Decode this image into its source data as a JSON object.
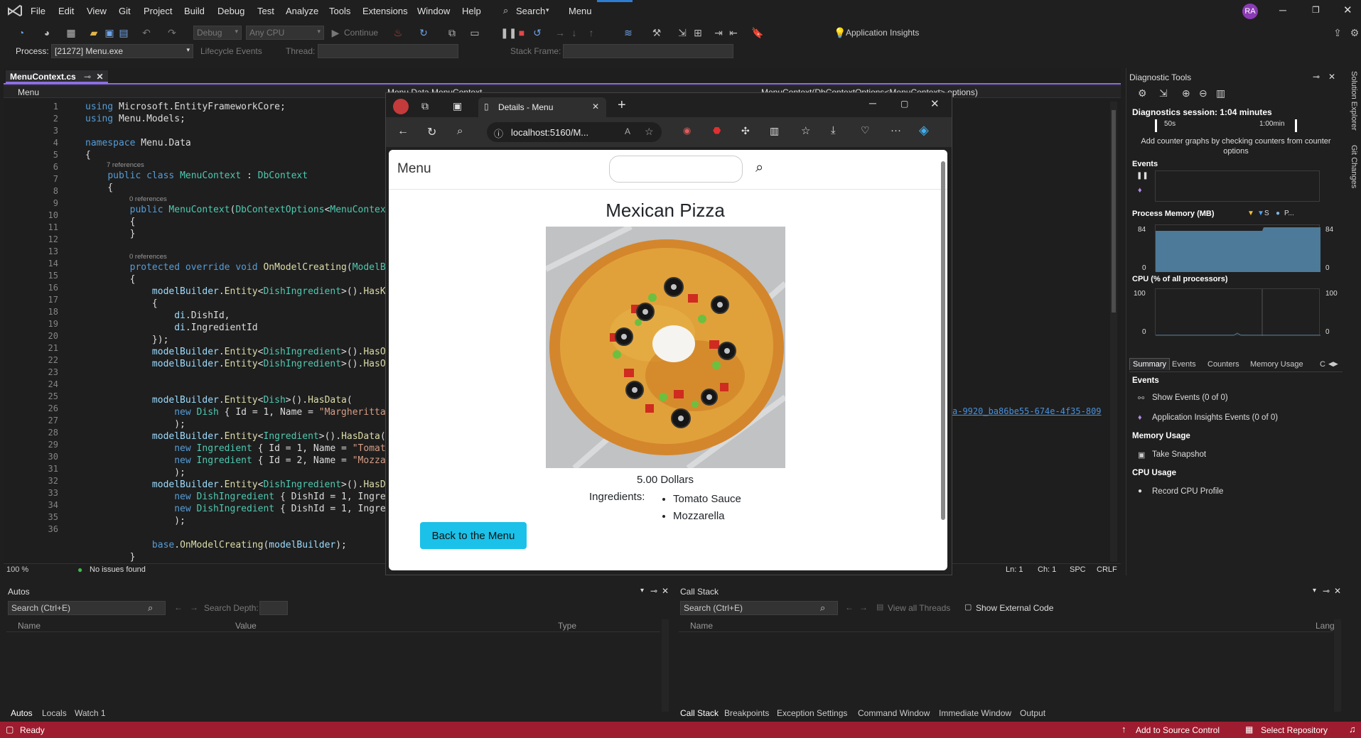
{
  "menubar": {
    "items": [
      "File",
      "Edit",
      "View",
      "Git",
      "Project",
      "Build",
      "Debug",
      "Test",
      "Analyze",
      "Tools",
      "Extensions",
      "Window",
      "Help"
    ],
    "search": "Search",
    "title": "Menu",
    "avatar": "RA"
  },
  "toolbar": {
    "config": "Debug",
    "platform": "Any CPU",
    "continue": "Continue",
    "insights": "Application Insights"
  },
  "toolbar2": {
    "process_label": "Process:",
    "process_value": "[21272] Menu.exe",
    "lifecycle": "Lifecycle Events",
    "thread": "Thread:",
    "stackframe": "Stack Frame:"
  },
  "editor": {
    "tab": "MenuContext.cs",
    "nav_left": "Menu",
    "nav_mid": "Menu.Data.MenuContext",
    "nav_right": "MenuContext(DbContextOptions<MenuContext> options)",
    "zoom": "100 %",
    "issues": "No issues found",
    "ln": "Ln: 1",
    "ch": "Ch: 1",
    "spc": "SPC",
    "crlf": "CRLF",
    "guid": "a-9920_ba86be55-674e-4f35-809",
    "refs": {
      "r7": "7 references",
      "r0a": "0 references",
      "r0b": "0 references"
    },
    "lines": [
      "1",
      "2",
      "3",
      "4",
      "5",
      "6",
      "7",
      "8",
      "9",
      "10",
      "11",
      "12",
      "13",
      "14",
      "15",
      "16",
      "17",
      "18",
      "19",
      "20",
      "21",
      "22",
      "23",
      "24",
      "25",
      "26",
      "27",
      "28",
      "29",
      "30",
      "31",
      "32",
      "33",
      "34",
      "35",
      "36"
    ]
  },
  "browser": {
    "tab_title": "Details - Menu",
    "url": "localhost:5160/M..."
  },
  "page": {
    "brand": "Menu",
    "search_placeholder": "",
    "title": "Mexican Pizza",
    "price": "5.00 Dollars",
    "ingredients_label": "Ingredients:",
    "ingredients": [
      "Tomato Sauce",
      "Mozzarella"
    ],
    "back_button": "Back to the Menu"
  },
  "diagnostics": {
    "title": "Diagnostic Tools",
    "session": "Diagnostics session: 1:04 minutes",
    "t1": "50s",
    "t2": "1:00min",
    "hint": "Add counter graphs by checking counters from counter options",
    "events": "Events",
    "memory": "Process Memory (MB)",
    "mem_legend_s": "S",
    "mem_legend_p": "P...",
    "mem_max": "84",
    "mem_min": "0",
    "cpu": "CPU (% of all processors)",
    "cpu_max": "100",
    "cpu_min": "0",
    "tabs": [
      "Summary",
      "Events",
      "Counters",
      "Memory Usage",
      "C"
    ],
    "sec_events": "Events",
    "show_events": "Show Events (0 of 0)",
    "ai_events": "Application Insights Events (0 of 0)",
    "sec_memory": "Memory Usage",
    "snapshot": "Take Snapshot",
    "sec_cpu": "CPU Usage",
    "record_cpu": "Record CPU Profile"
  },
  "side_tabs": [
    "Solution Explorer",
    "Git Changes"
  ],
  "autos": {
    "title": "Autos",
    "search": "Search (Ctrl+E)",
    "depth": "Search Depth:",
    "cols": [
      "Name",
      "Value",
      "Type"
    ],
    "tabs": [
      "Autos",
      "Locals",
      "Watch 1"
    ]
  },
  "callstack": {
    "title": "Call Stack",
    "search": "Search (Ctrl+E)",
    "view_threads": "View all Threads",
    "show_external": "Show External Code",
    "cols": [
      "Name",
      "Lang"
    ],
    "tabs": [
      "Call Stack",
      "Breakpoints",
      "Exception Settings",
      "Command Window",
      "Immediate Window",
      "Output"
    ]
  },
  "status": {
    "ready": "Ready",
    "source": "Add to Source Control",
    "repo": "Select Repository"
  }
}
